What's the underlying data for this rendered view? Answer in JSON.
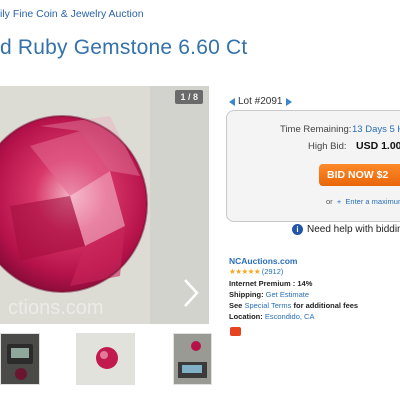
{
  "breadcrumb": "ily Fine Coin & Jewelry Auction",
  "title": "d Ruby Gemstone 6.60 Ct",
  "gallery": {
    "counter": "1 / 8",
    "watermark": "ctions.com",
    "next_icon": "chevron-right-icon",
    "thumbnails": [
      "scale-photo",
      "gem-photo",
      "scale-photo-2"
    ]
  },
  "lot": {
    "label": "Lot #2091"
  },
  "bidding": {
    "time_label": "Time Remaining:",
    "time_value": "13 Days 5 H",
    "high_bid_label": "High Bid:",
    "high_bid_value": "USD 1.00",
    "bid_button": "BID NOW $2",
    "max_prefix": "or",
    "max_link": "Enter a maximum"
  },
  "help": {
    "text": "Need help with bidding"
  },
  "seller": {
    "name": "NCAuctions.com",
    "stars": "★★★★★",
    "review_count": "(2912)",
    "premium_label": "Internet Premium :",
    "premium_value": "14%",
    "shipping_label": "Shipping:",
    "shipping_value": "Get Estimate",
    "terms_prefix": "See",
    "terms_link": "Special Terms",
    "terms_suffix": "for additional fees",
    "location_label": "Location:",
    "location_value": "Escondido, CA"
  },
  "colors": {
    "link": "#2a6fb8",
    "title": "#3472aa",
    "bid_button": "#f07a1a",
    "ruby": "#c21a4e"
  }
}
